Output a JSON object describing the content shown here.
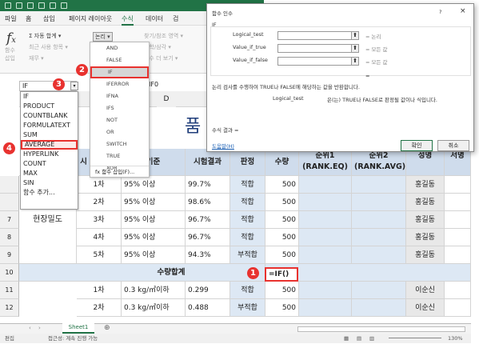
{
  "menubar": {
    "items": [
      "파일",
      "홈",
      "삽입",
      "페이지 레이아웃",
      "수식",
      "데이터",
      "검"
    ],
    "active_index": 4
  },
  "ribbon": {
    "autosum": "Σ 자동 합계 ▾",
    "recent": "최근 사용 항목 ▾",
    "financial": "재무 ▾",
    "fx_labels": [
      "함수",
      "삽입"
    ],
    "logical_btn": "논리 ▾",
    "lookup": "찾기/참조 영역 ▾",
    "math": "수학/삼각 ▾",
    "more": "함수 더 보기 ▾"
  },
  "namebox": {
    "value": "IF"
  },
  "formula": {
    "text": "IF0"
  },
  "function_list": {
    "items": [
      "IF",
      "PRODUCT",
      "COUNTBLANK",
      "FORMULATEXT",
      "SUM",
      "AVERAGE",
      "HYPERLINK",
      "COUNT",
      "MAX",
      "SIN",
      "함수 추가..."
    ],
    "highlighted_index": 5
  },
  "logical_menu": {
    "items": [
      "AND",
      "FALSE",
      "IF",
      "IFERROR",
      "IFNA",
      "IFS",
      "NOT",
      "OR",
      "SWITCH",
      "TRUE",
      "XOR"
    ],
    "highlighted_index": 2,
    "footer": "fx 함수 삽입(F)..."
  },
  "dialog": {
    "title": "함수 인수",
    "help": "?",
    "close": "×",
    "fn_name": "IF",
    "args": [
      {
        "label": "Logical_test",
        "result": "= 논리"
      },
      {
        "label": "Value_if_true",
        "result": "= 모든 값"
      },
      {
        "label": "Value_if_false",
        "result": "= 모든 값"
      }
    ],
    "result_eq": "=",
    "description": "논리 검사를 수행하여 TRUE나 FALSE에 해당하는 값을 반환합니다.",
    "arg_desc_label": "Logical_test",
    "arg_desc": "은(는) TRUE나 FALSE로 판정될 값이나 식입니다.",
    "formula_result": "수식 결과 =",
    "help_link": "도움말(H)",
    "ok": "확인",
    "cancel": "취소"
  },
  "grid": {
    "title_fragment": "품",
    "col_letters": [
      "D"
    ],
    "headers": [
      "시",
      "기준",
      "시험결과",
      "판정",
      "수량",
      "순위1 (RANK.EQ)",
      "순위2 (RANK.AVG)",
      "성명",
      "서명"
    ],
    "row_numbers": [
      "7",
      "8",
      "9",
      "10",
      "11",
      "12"
    ],
    "group_label": "현장밀도",
    "rows": [
      {
        "trial": "1차",
        "std": "95% 이상",
        "result": "99.7%",
        "judge": "적합",
        "qty": "500",
        "name": "홍길동"
      },
      {
        "trial": "2차",
        "std": "95% 이상",
        "result": "98.6%",
        "judge": "적합",
        "qty": "500",
        "name": "홍길동"
      },
      {
        "trial": "3차",
        "std": "95% 이상",
        "result": "96.7%",
        "judge": "적합",
        "qty": "500",
        "name": "홍길동"
      },
      {
        "trial": "4차",
        "std": "95% 이상",
        "result": "96.7%",
        "judge": "적합",
        "qty": "500",
        "name": "홍길동"
      },
      {
        "trial": "5차",
        "std": "95% 이상",
        "result": "94.3%",
        "judge": "부적합",
        "qty": "500",
        "name": "홍길동"
      }
    ],
    "total_label": "수량합계",
    "total_formula": "=IF()",
    "rows2": [
      {
        "trial": "1차",
        "std": "0.3 kg/㎥이하",
        "result": "0.299",
        "judge": "적합",
        "qty": "500",
        "name": "이순신"
      },
      {
        "trial": "2차",
        "std": "0.3 kg/㎥이하",
        "result": "0.488",
        "judge": "부적합",
        "qty": "500",
        "name": "이순신"
      }
    ]
  },
  "sheet_tab": "Sheet1",
  "status": {
    "mode": "편집",
    "accessibility": "접근성: 계속 진행 가능",
    "zoom": "130%"
  },
  "markers": [
    "1",
    "2",
    "3",
    "4"
  ],
  "colors": {
    "accent": "#e8322f",
    "excel_green": "#217346",
    "header_blue": "#cfdcec",
    "cell_blue": "#dde8f4"
  }
}
